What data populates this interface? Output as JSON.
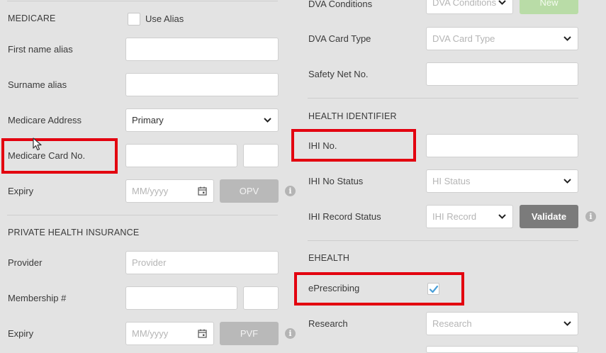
{
  "medicare": {
    "section_title": "MEDICARE",
    "use_alias_label": "Use Alias",
    "use_alias_checked": false,
    "first_name_alias_label": "First name alias",
    "first_name_alias_value": "",
    "surname_alias_label": "Surname alias",
    "surname_alias_value": "",
    "address_label": "Medicare Address",
    "address_value": "Primary",
    "card_no_label": "Medicare Card No.",
    "card_no_value": "",
    "card_irn_value": "",
    "expiry_label": "Expiry",
    "expiry_placeholder": "MM/yyyy",
    "opv_label": "OPV"
  },
  "private_health": {
    "section_title": "PRIVATE HEALTH INSURANCE",
    "provider_label": "Provider",
    "provider_placeholder": "Provider",
    "membership_label": "Membership #",
    "membership_value": "",
    "membership_suffix_value": "",
    "expiry_label": "Expiry",
    "expiry_placeholder": "MM/yyyy",
    "pvf_label": "PVF"
  },
  "dva": {
    "conditions_label": "DVA Conditions",
    "conditions_placeholder": "DVA Conditions",
    "new_label": "New",
    "card_type_label": "DVA Card Type",
    "card_type_placeholder": "DVA Card Type",
    "safety_net_label": "Safety Net No.",
    "safety_net_value": ""
  },
  "health_identifier": {
    "section_title": "HEALTH IDENTIFIER",
    "ihi_no_label": "IHI No.",
    "ihi_no_value": "",
    "ihi_status_label": "IHI No Status",
    "ihi_status_placeholder": "HI Status",
    "ihi_record_label": "IHI Record Status",
    "ihi_record_placeholder": "IHI Record",
    "validate_label": "Validate"
  },
  "ehealth": {
    "section_title": "EHEALTH",
    "eprescribing_label": "ePrescribing",
    "eprescribing_checked": true,
    "research_label": "Research",
    "research_placeholder": "Research"
  },
  "colors": {
    "highlight": "#e3000f",
    "check": "#4a9fd8",
    "new_button": "#b9dca7"
  }
}
